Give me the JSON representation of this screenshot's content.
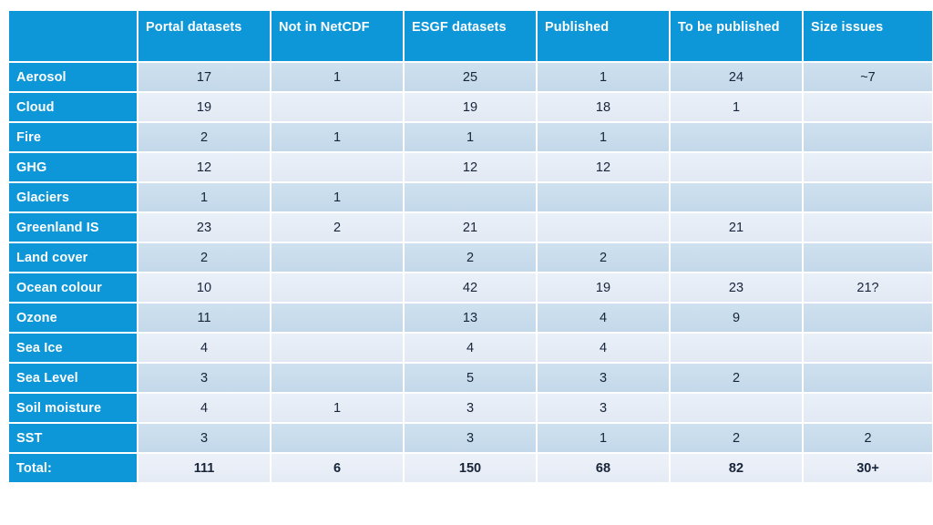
{
  "table": {
    "columns": [
      "",
      "Portal datasets",
      "Not in NetCDF",
      "ESGF datasets",
      "Published",
      "To be published",
      "Size issues"
    ],
    "rows": [
      {
        "label": "Aerosol",
        "values": [
          "17",
          "1",
          "25",
          "1",
          "24",
          "~7"
        ]
      },
      {
        "label": "Cloud",
        "values": [
          "19",
          "",
          "19",
          "18",
          "1",
          ""
        ]
      },
      {
        "label": "Fire",
        "values": [
          "2",
          "1",
          "1",
          "1",
          "",
          ""
        ]
      },
      {
        "label": "GHG",
        "values": [
          "12",
          "",
          "12",
          "12",
          "",
          ""
        ]
      },
      {
        "label": "Glaciers",
        "values": [
          "1",
          "1",
          "",
          "",
          "",
          ""
        ]
      },
      {
        "label": "Greenland IS",
        "values": [
          "23",
          "2",
          "21",
          "",
          "21",
          ""
        ]
      },
      {
        "label": "Land cover",
        "values": [
          "2",
          "",
          "2",
          "2",
          "",
          ""
        ]
      },
      {
        "label": "Ocean colour",
        "values": [
          "10",
          "",
          "42",
          "19",
          "23",
          "21?"
        ]
      },
      {
        "label": "Ozone",
        "values": [
          "11",
          "",
          "13",
          "4",
          "9",
          ""
        ]
      },
      {
        "label": "Sea Ice",
        "values": [
          "4",
          "",
          "4",
          "4",
          "",
          ""
        ]
      },
      {
        "label": "Sea Level",
        "values": [
          "3",
          "",
          "5",
          "3",
          "2",
          ""
        ]
      },
      {
        "label": "Soil moisture",
        "values": [
          "4",
          "1",
          "3",
          "3",
          "",
          ""
        ]
      },
      {
        "label": "SST",
        "values": [
          "3",
          "",
          "3",
          "1",
          "2",
          "2"
        ]
      }
    ],
    "total": {
      "label": "Total:",
      "values": [
        "111",
        "6",
        "150",
        "68",
        "82",
        "30+"
      ]
    }
  },
  "colors": {
    "header_blue": "#0d96d8",
    "row_dark": "#c8dced",
    "row_light": "#e6ecf6",
    "text_dark": "#17243a",
    "text_light": "#ffffff",
    "page_background": "#ffffff"
  }
}
